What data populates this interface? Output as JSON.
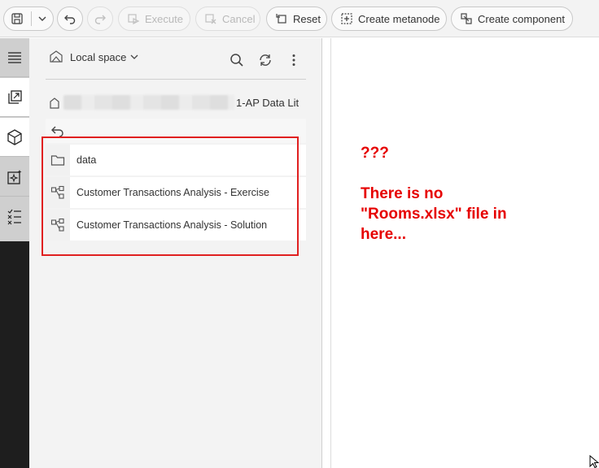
{
  "toolbar": {
    "execute_label": "Execute",
    "cancel_label": "Cancel",
    "reset_label": "Reset",
    "create_metanode_label": "Create metanode",
    "create_component_label": "Create component"
  },
  "explorer": {
    "space_label": "Local space",
    "path_text": "1-AP Data Lit",
    "items": [
      {
        "label": "data",
        "icon": "folder-icon"
      },
      {
        "label": "Customer Transactions Analysis - Exercise",
        "icon": "workflow-icon"
      },
      {
        "label": "Customer Transactions Analysis - Solution",
        "icon": "workflow-icon"
      }
    ]
  },
  "annotation": {
    "line1": "???",
    "line2": "There is no",
    "line3": "\"Rooms.xlsx\" file in",
    "line4": "here..."
  },
  "colors": {
    "annotation": "#e60000",
    "highlight_box": "#e02020",
    "rail_dark": "#1e1e1e"
  }
}
